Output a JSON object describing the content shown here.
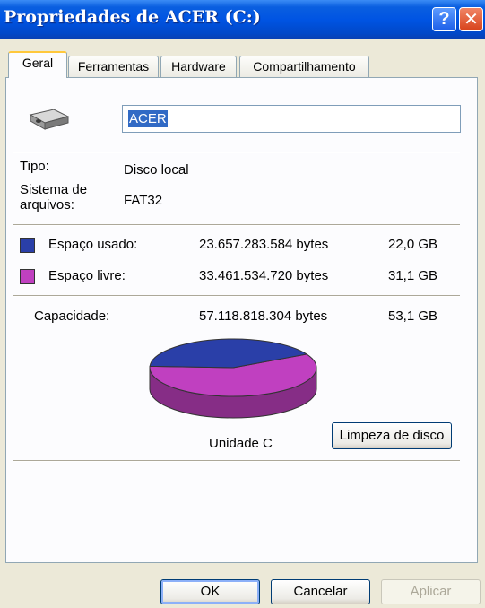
{
  "window": {
    "title": "Propriedades de ACER (C:)",
    "help_glyph": "?",
    "close_glyph": "✕"
  },
  "tabs": [
    {
      "label": "Geral",
      "active": true
    },
    {
      "label": "Ferramentas",
      "active": false
    },
    {
      "label": "Hardware",
      "active": false
    },
    {
      "label": "Compartilhamento",
      "active": false
    }
  ],
  "drive": {
    "icon": "hard-drive-icon",
    "name": "ACER",
    "type_label": "Tipo:",
    "type_value": "Disco local",
    "fs_label_line1": "Sistema de",
    "fs_label_line2": "arquivos:",
    "fs_value": "FAT32"
  },
  "usage": {
    "used_label": "Espaço usado:",
    "used_bytes": "23.657.283.584 bytes",
    "used_gb": "22,0 GB",
    "free_label": "Espaço livre:",
    "free_bytes": "33.461.534.720 bytes",
    "free_gb": "31,1 GB",
    "capacity_label": "Capacidade:",
    "capacity_bytes": "57.118.818.304 bytes",
    "capacity_gb": "53,1 GB",
    "used_color": "#2a3fa8",
    "free_color": "#c040c0",
    "used_fraction": 0.414
  },
  "disk_label": "Unidade C",
  "cleanup_button": "Limpeza de disco",
  "footer": {
    "ok": "OK",
    "cancel": "Cancelar",
    "apply": "Aplicar"
  }
}
